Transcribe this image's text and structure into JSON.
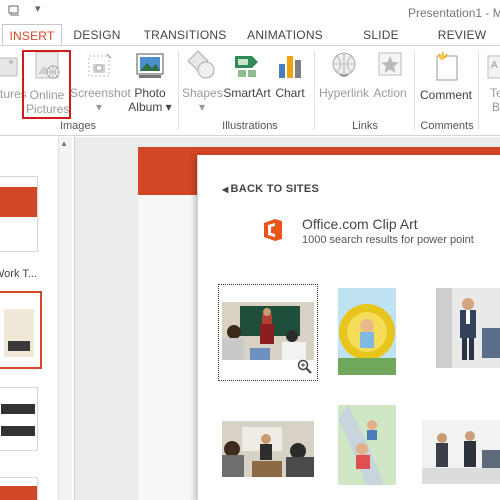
{
  "window": {
    "title": "Presentation1 - Mi"
  },
  "tabs": [
    {
      "label": "INSERT",
      "active": true
    },
    {
      "label": "DESIGN"
    },
    {
      "label": "TRANSITIONS"
    },
    {
      "label": "ANIMATIONS"
    },
    {
      "label": "SLIDE SHOW"
    },
    {
      "label": "REVIEW"
    }
  ],
  "ribbon": {
    "pictures_label": "ctures",
    "online_pictures_line1": "Online",
    "online_pictures_line2": "Pictures",
    "screenshot_label": "Screenshot",
    "photo_album_line1": "Photo",
    "photo_album_line2": "Album",
    "shapes_label": "Shapes",
    "smartart_label": "SmartArt",
    "chart_label": "Chart",
    "hyperlink_label": "Hyperlink",
    "action_label": "Action",
    "comment_label": "Comment",
    "text_box_line1": "Te",
    "text_box_line2": "B",
    "groups": {
      "images": "Images",
      "illustrations": "Illustrations",
      "links": "Links",
      "comments": "Comments"
    }
  },
  "thumbnails": {
    "partial_label": "Work T..."
  },
  "dialog": {
    "back_label": "BACK TO SITES",
    "source_title": "Office.com Clip Art",
    "source_subtitle": "1000 search results for power point"
  },
  "colors": {
    "accent": "#d24726",
    "highlight": "#d11a1a"
  }
}
